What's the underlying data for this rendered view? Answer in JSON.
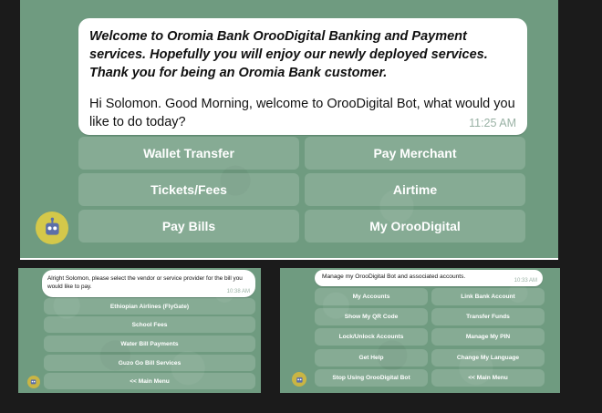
{
  "panel1": {
    "welcome_text": "Welcome to Oromia Bank OrooDigital Banking and Payment services. Hopefully you will enjoy our newly deployed services. Thank you for being an Oromia Bank customer.",
    "greeting_text": "Hi Solomon. Good Morning, welcome to OrooDigital Bot, what would you like to do today?",
    "time": "11:25 AM",
    "buttons": [
      "Wallet Transfer",
      "Pay Merchant",
      "Tickets/Fees",
      "Airtime",
      "Pay Bills",
      "My OrooDigital"
    ],
    "avatar_icon": "robot-icon"
  },
  "panel2": {
    "message": "Alright Solomon, please select the vendor or service provider for the bill you would like to pay.",
    "time": "10:38 AM",
    "buttons": [
      "Ethiopian Airlines (FlyGate)",
      "School Fees",
      "Water Bill Payments",
      "Guzo Go Bill Services",
      "<< Main Menu"
    ],
    "avatar_icon": "robot-icon"
  },
  "panel3": {
    "message": "Manage my OrooDigital Bot and associated accounts.",
    "time": "10:33 AM",
    "buttons": [
      "My Accounts",
      "Link Bank Account",
      "Show My QR Code",
      "Transfer Funds",
      "Lock/Unlock Accounts",
      "Manage My PIN",
      "Get Help",
      "Change My Language",
      "Stop Using OrooDigital Bot",
      "<< Main Menu"
    ],
    "avatar_icon": "robot-icon"
  },
  "colors": {
    "chat_background": "#6f9b80",
    "bubble": "#ffffff",
    "timestamp": "#9ab2a5"
  }
}
